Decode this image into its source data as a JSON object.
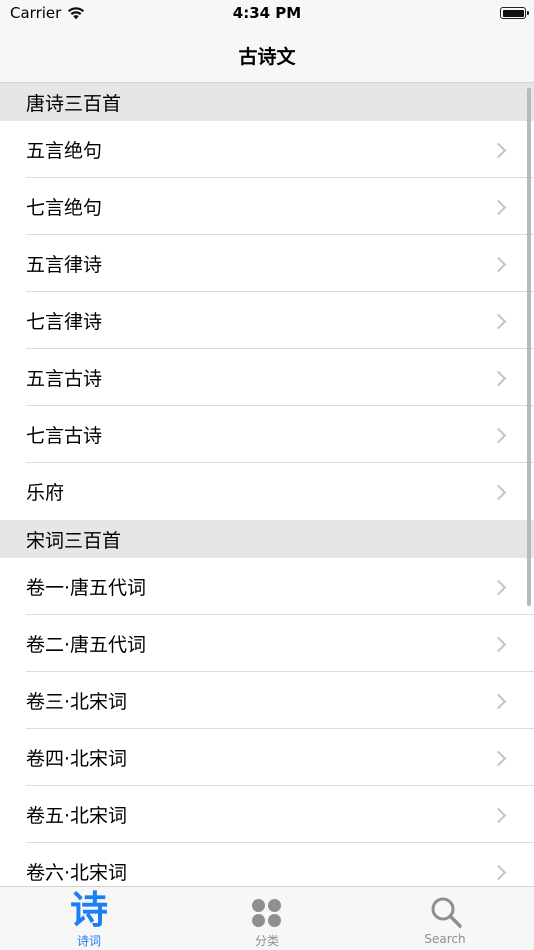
{
  "status_bar": {
    "carrier": "Carrier",
    "time": "4:34 PM"
  },
  "nav": {
    "title": "古诗文"
  },
  "sections": [
    {
      "header": "唐诗三百首",
      "items": [
        "五言绝句",
        "七言绝句",
        "五言律诗",
        "七言律诗",
        "五言古诗",
        "七言古诗",
        "乐府"
      ]
    },
    {
      "header": "宋词三百首",
      "items": [
        "卷一·唐五代词",
        "卷二·唐五代词",
        "卷三·北宋词",
        "卷四·北宋词",
        "卷五·北宋词",
        "卷六·北宋词"
      ]
    }
  ],
  "tabs": [
    {
      "label": "诗词",
      "icon": "shi-character-icon",
      "glyph": "诗",
      "active": true
    },
    {
      "label": "分类",
      "icon": "four-dots-icon",
      "active": false
    },
    {
      "label": "Search",
      "icon": "search-icon",
      "active": false
    }
  ],
  "colors": {
    "accent": "#1a7ef5",
    "inactive": "#8e8e93",
    "section_bg": "#e6e6e6",
    "bar_bg": "#f7f7f7"
  }
}
